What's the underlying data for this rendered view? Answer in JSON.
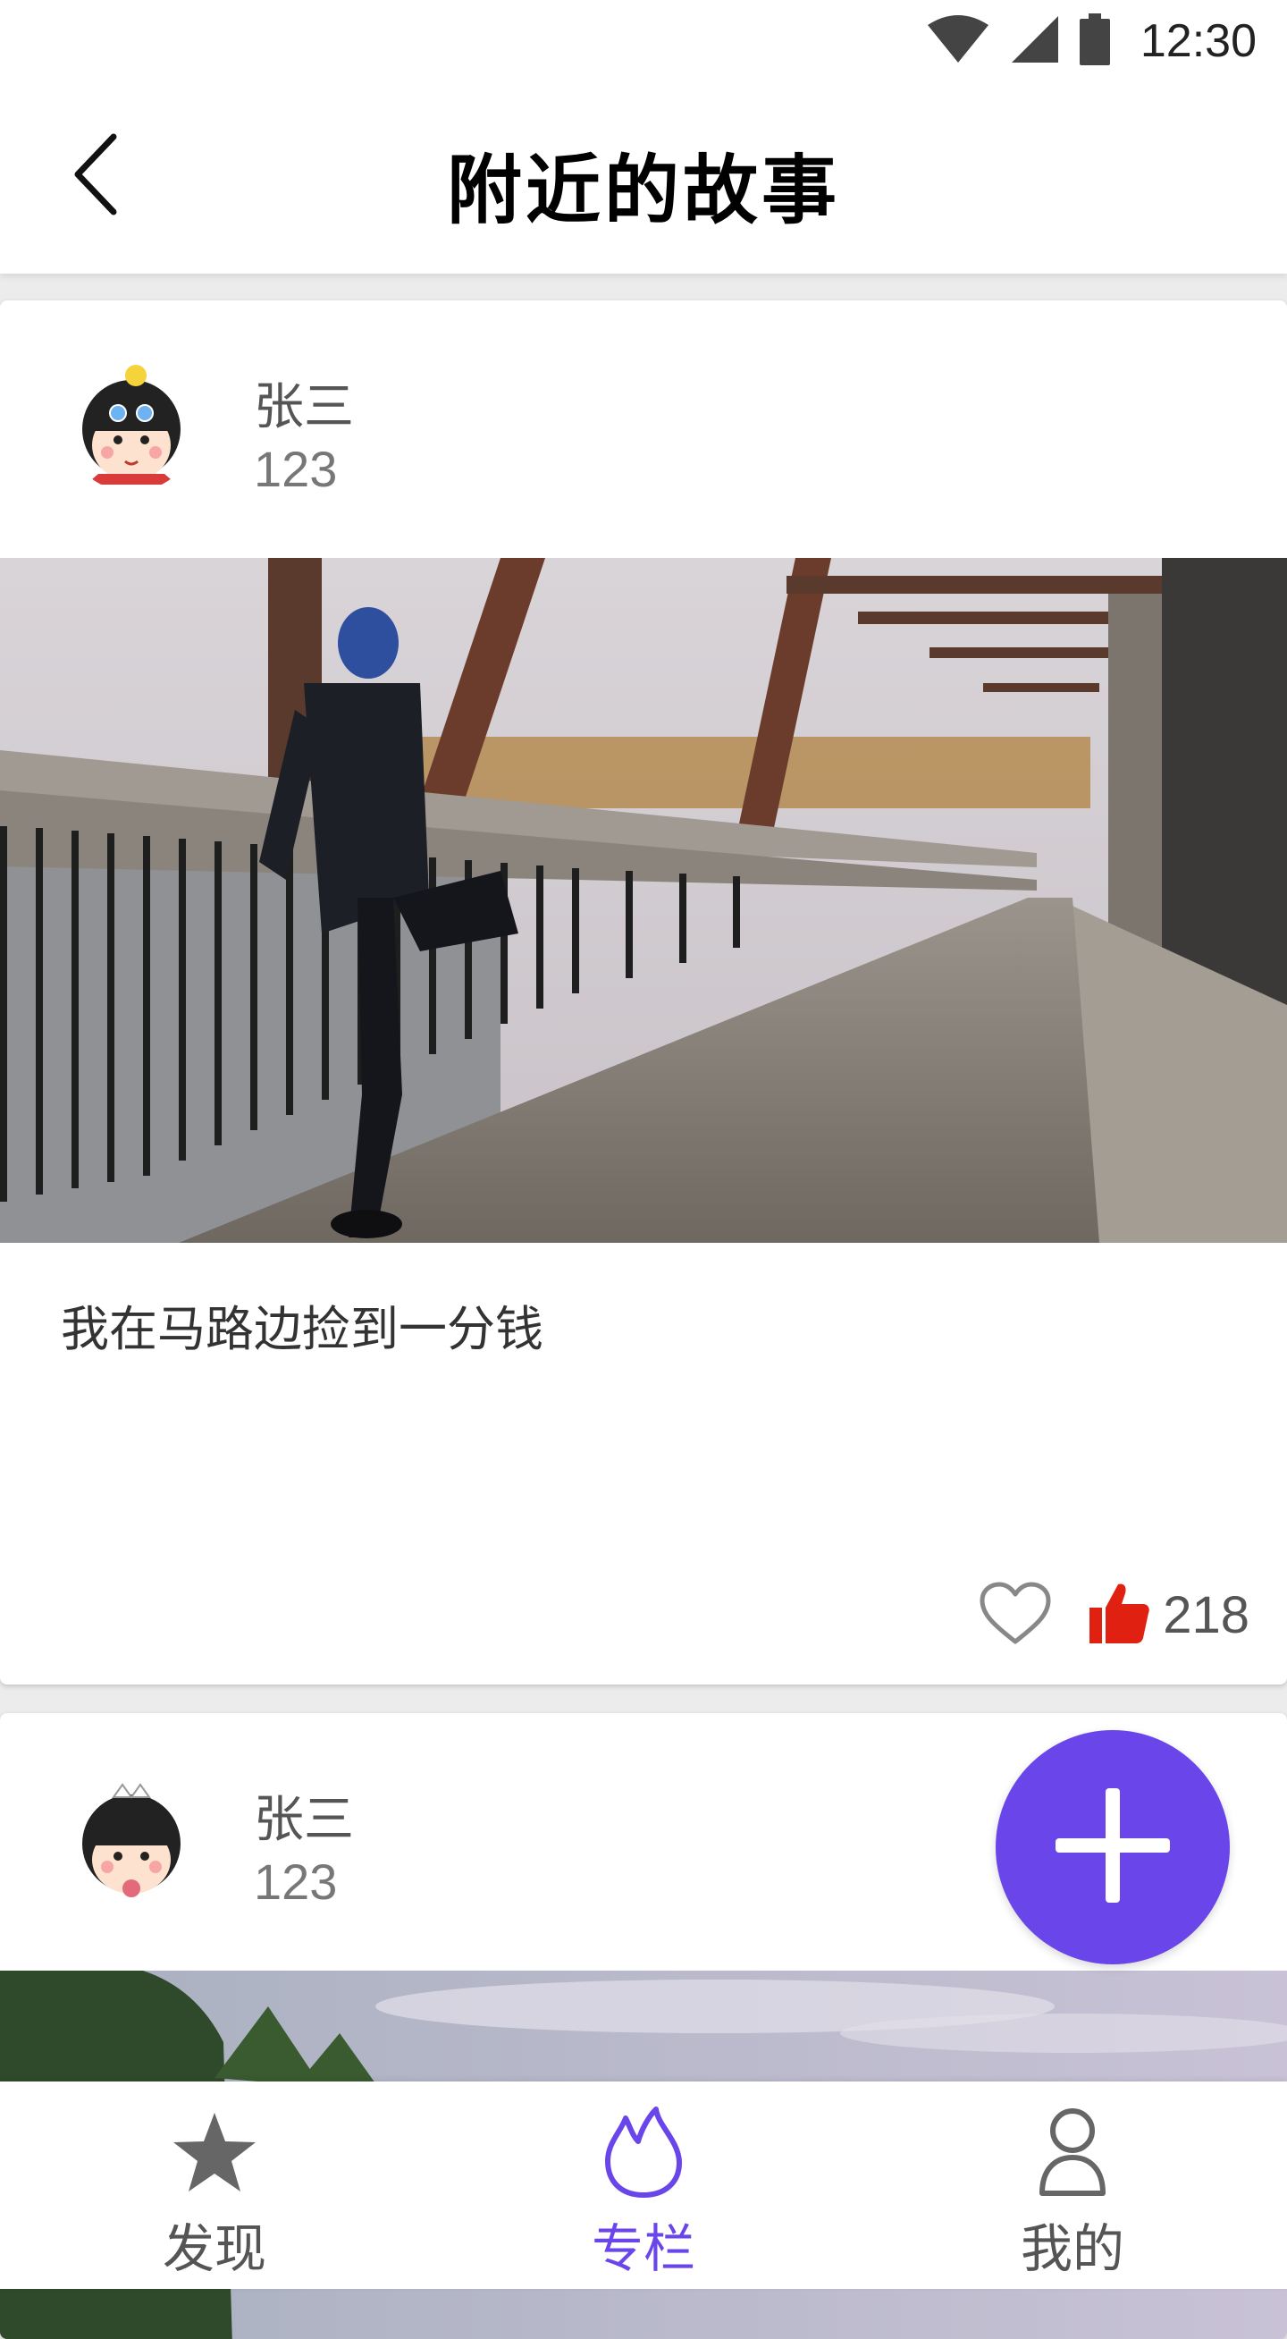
{
  "status_bar": {
    "time": "12:30",
    "icons": [
      "wifi-icon",
      "signal-icon",
      "battery-icon"
    ]
  },
  "header": {
    "title": "附近的故事",
    "back_icon": "chevron-left-icon"
  },
  "posts": [
    {
      "author": "张三",
      "subtitle": "123",
      "avatar_icon": "cartoon-girl-avatar",
      "image": "runner-stretching-on-bridge-photo",
      "text": "我在马路边捡到一分钱",
      "likes": "218",
      "favorite_icon": "heart-outline-icon",
      "like_icon": "thumbs-up-icon"
    },
    {
      "author": "张三",
      "subtitle": "123",
      "avatar_icon": "cartoon-girl-avatar",
      "image": "sky-and-trees-photo"
    }
  ],
  "fab": {
    "icon": "plus-icon"
  },
  "bottom_nav": {
    "items": [
      {
        "label": "发现",
        "icon": "star-icon",
        "active": false
      },
      {
        "label": "专栏",
        "icon": "flame-icon",
        "active": true
      },
      {
        "label": "我的",
        "icon": "person-icon",
        "active": false
      }
    ]
  },
  "colors": {
    "accent": "#6a46ea",
    "like_red": "#e02010",
    "text_dark": "#000000",
    "text_muted": "#555555",
    "background": "#ececec"
  }
}
